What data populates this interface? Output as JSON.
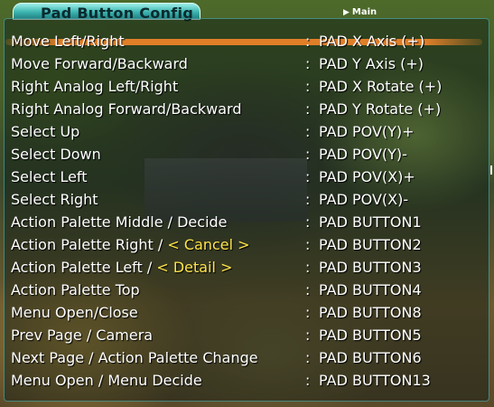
{
  "title": "Pad Button Config",
  "nav": {
    "main_label": "Main"
  },
  "selected_index": 0,
  "rows": [
    {
      "label": "Move Left/Right",
      "value": "PAD X Axis (+)"
    },
    {
      "label": "Move Forward/Backward",
      "value": "PAD Y Axis (+)"
    },
    {
      "label": "Right Analog Left/Right",
      "value": "PAD X Rotate (+)"
    },
    {
      "label": "Right Analog Forward/Backward",
      "value": "PAD Y Rotate (+)"
    },
    {
      "label": "Select Up",
      "value": "PAD POV(Y)+"
    },
    {
      "label": "Select Down",
      "value": "PAD POV(Y)-"
    },
    {
      "label": "Select Left",
      "value": "PAD POV(X)+"
    },
    {
      "label": "Select Right",
      "value": "PAD POV(X)-"
    },
    {
      "label": "Action Palette Middle / Decide",
      "value": "PAD BUTTON1"
    },
    {
      "label_prefix": "Action Palette Right / ",
      "label_bracketed": "Cancel",
      "value": "PAD BUTTON2"
    },
    {
      "label_prefix": "Action Palette Left / ",
      "label_bracketed": "Detail",
      "value": "PAD BUTTON3"
    },
    {
      "label": "Action Palette Top",
      "value": "PAD BUTTON4"
    },
    {
      "label": "Menu Open/Close",
      "value": "PAD BUTTON8"
    },
    {
      "label": "Prev Page / Camera",
      "value": "PAD BUTTON5"
    },
    {
      "label": "Next Page / Action Palette Change",
      "value": "PAD BUTTON6"
    },
    {
      "label": "Menu Open / Menu Decide",
      "value": "PAD BUTTON13"
    }
  ],
  "colors": {
    "selection_bar": "#ff8a2a",
    "bracket_text": "#ffe44a",
    "tab": "#3cb4b0"
  }
}
